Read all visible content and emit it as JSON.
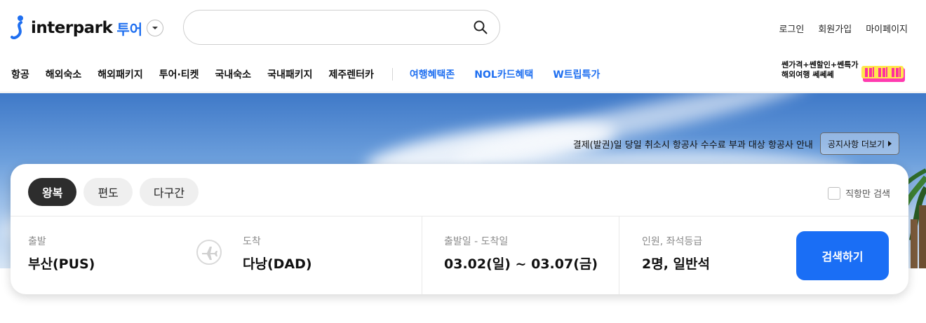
{
  "brand": {
    "name": "interpark",
    "sub": "투어",
    "accent": "#1f6ff0"
  },
  "search": {
    "value": "",
    "placeholder": ""
  },
  "util_links": [
    "로그인",
    "회원가입",
    "마이페이지"
  ],
  "gnb": {
    "items": [
      "항공",
      "해외숙소",
      "해외패키지",
      "투어·티켓",
      "국내숙소",
      "국내패키지",
      "제주렌터카"
    ],
    "highlight_items": [
      "여행혜택존",
      "NOL카드혜택",
      "W트립특가"
    ]
  },
  "promo": {
    "line1": "쎈가격+쎈할인+쎈특가",
    "line2": "해외여행 쎄쎄쎄"
  },
  "notice": {
    "text": "결제(발권)일 당일 취소시 항공사 수수료 부과 대상 항공사 안내",
    "button": "공지사항 더보기"
  },
  "trip_types": [
    "왕복",
    "편도",
    "다구간"
  ],
  "active_trip_type": "왕복",
  "direct_only": {
    "label": "직항만 검색",
    "checked": false
  },
  "fields": {
    "departure": {
      "label": "출발",
      "value": "부산(PUS)"
    },
    "arrival": {
      "label": "도착",
      "value": "다낭(DAD)"
    },
    "dates": {
      "label": "출발일 - 도착일",
      "value": "03.02(일) ~ 03.07(금)"
    },
    "passengers": {
      "label": "인원, 좌석등급",
      "value": "2명, 일반석"
    }
  },
  "search_button": "검색하기",
  "colors": {
    "primary_button": "#1a6ef5",
    "active_tab": "#2d2d2d"
  }
}
